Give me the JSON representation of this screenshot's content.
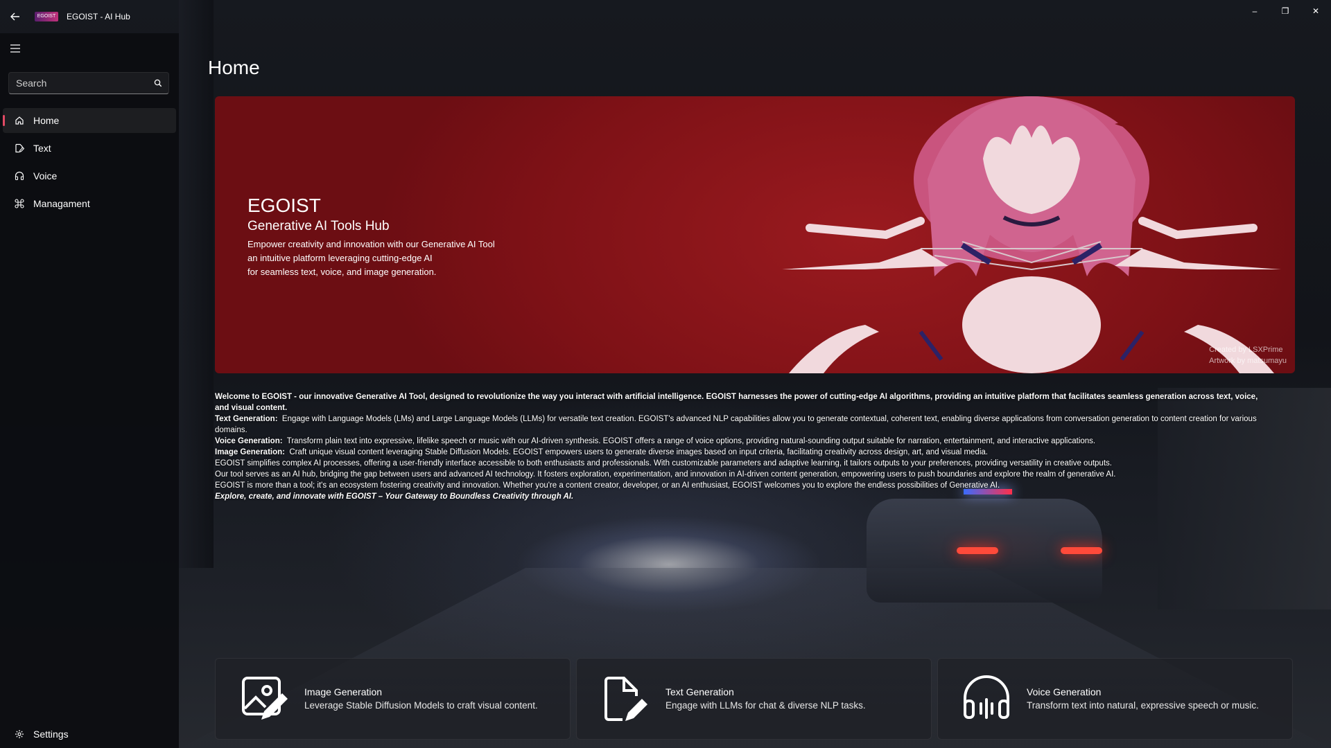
{
  "window": {
    "title": "EGOIST - AI Hub",
    "logo_text": "EGOIST",
    "controls": {
      "minimize": "–",
      "restore": "❐",
      "close": "✕"
    }
  },
  "sidebar": {
    "search_placeholder": "Search",
    "items": [
      {
        "label": "Home",
        "icon": "home-icon",
        "active": true
      },
      {
        "label": "Text",
        "icon": "edit-icon",
        "active": false
      },
      {
        "label": "Voice",
        "icon": "headphones-icon",
        "active": false
      },
      {
        "label": "Managament",
        "icon": "command-icon",
        "active": false
      }
    ],
    "settings_label": "Settings"
  },
  "page": {
    "title": "Home"
  },
  "hero": {
    "title": "EGOIST",
    "subtitle": "Generative AI Tools Hub",
    "lines": [
      "Empower creativity and innovation with our Generative AI Tool",
      "an intuitive platform leveraging cutting-edge AI",
      "for seamless text, voice, and image generation."
    ],
    "credit_1": "Created by LSXPrime",
    "credit_2": "Artwork by matsumayu"
  },
  "intro": {
    "welcome": "Welcome to EGOIST - our innovative Generative AI Tool, designed to revolutionize the way you interact with artificial intelligence. EGOIST harnesses the power of cutting-edge AI algorithms, providing an intuitive platform that facilitates seamless generation across text, voice, and visual content.",
    "text_label": "Text Generation:",
    "text_body": "Engage with Language Models (LMs) and Large Language Models (LLMs) for versatile text creation. EGOIST's advanced NLP capabilities allow you to generate contextual, coherent text, enabling diverse applications from conversation generation to content creation for various domains.",
    "voice_label": "Voice Generation:",
    "voice_body": "Transform plain text into expressive, lifelike speech or music with our AI-driven synthesis. EGOIST offers a range of voice options, providing natural-sounding output suitable for narration, entertainment, and interactive applications.",
    "image_label": "Image Generation:",
    "image_body": "Craft unique visual content leveraging Stable Diffusion Models. EGOIST empowers users to generate diverse images based on input criteria, facilitating creativity across design, art, and visual media.",
    "para_simplifies": "EGOIST simplifies complex AI processes, offering a user-friendly interface accessible to both enthusiasts and professionals. With customizable parameters and adaptive learning, it tailors outputs to your preferences, providing versatility in creative outputs.",
    "para_hub": "Our tool serves as an AI hub, bridging the gap between users and advanced AI technology. It fosters exploration, experimentation, and innovation in AI-driven content generation, empowering users to push boundaries and explore the realm of generative AI.",
    "para_more": "EGOIST is more than a tool; it's an ecosystem fostering creativity and innovation. Whether you're a content creator, developer, or an AI enthusiast, EGOIST welcomes you to explore the endless possibilities of Generative AI.",
    "closing": "Explore, create, and innovate with EGOIST – Your Gateway to Boundless Creativity through AI."
  },
  "cards": [
    {
      "title": "Image Generation",
      "desc": "Leverage Stable Diffusion Models to craft visual content.",
      "icon": "image-edit-icon"
    },
    {
      "title": "Text Generation",
      "desc": "Engage with LLMs  for chat & diverse NLP tasks.",
      "icon": "document-edit-icon"
    },
    {
      "title": "Voice Generation",
      "desc": "Transform text into natural, expressive speech or music.",
      "icon": "headphones-voice-icon"
    }
  ]
}
